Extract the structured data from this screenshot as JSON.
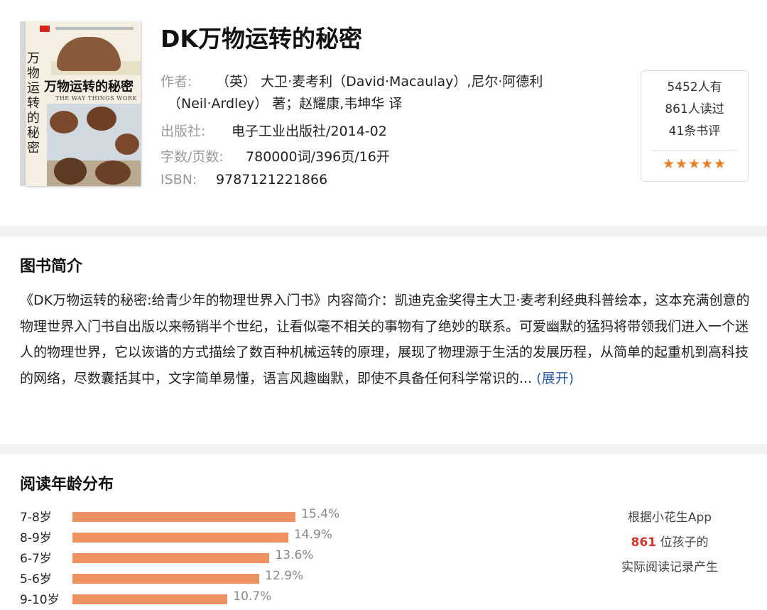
{
  "book": {
    "title": "DK万物运转的秘密",
    "author_label": "作者:",
    "author_line1": "（英） 大卫·麦考利（David·Macaulay）,尼尔·阿德利",
    "author_line2": "（Neil·Ardley） 著；赵耀康,韦坤华 译",
    "publisher_label": "出版社:",
    "publisher": "电子工业出版社/2014-02",
    "words_label": "字数/页数:",
    "words": "780000词/396页/16开",
    "isbn_label": "ISBN:",
    "isbn": "9787121221866"
  },
  "cover": {
    "vertical_title": "万物运转的秘密",
    "horizontal_title": "万物运转的秘密",
    "english_title": "THE WAY THINGS WORK"
  },
  "stats": {
    "owners": "5452人有",
    "readers": "861人读过",
    "reviews": "41条书评",
    "stars": "★★★★★",
    "star_color": "#ef7e23"
  },
  "intro": {
    "title": "图书简介",
    "text": "《DK万物运转的秘密:给青少年的物理世界入门书》内容简介：凯迪克金奖得主大卫·麦考利经典科普绘本，这本充满创意的物理世界入门书自出版以来畅销半个世纪，让看似毫不相关的事物有了绝妙的联系。可爱幽默的猛犸将带领我们进入一个迷人的物理世界，它以诙谐的方式描绘了数百种机械运转的原理，展现了物理源于生活的发展历程，从简单的起重机到高科技的网络，尽数囊括其中，文字简单易懂，语言风趣幽默，即使不具备任何科学常识的...",
    "more_label": "(展开)",
    "link_color": "#2e5fa8"
  },
  "age": {
    "title": "阅读年龄分布",
    "note_line1": "根据小花生App",
    "note_count": "861",
    "note_line2_rest": " 位孩子的",
    "note_line3": "实际阅读记录产生"
  },
  "chart_data": {
    "type": "bar",
    "orientation": "horizontal",
    "categories": [
      "7-8岁",
      "8-9岁",
      "6-7岁",
      "5-6岁",
      "9-10岁"
    ],
    "values": [
      15.4,
      14.9,
      13.6,
      12.9,
      10.7
    ],
    "value_labels": [
      "15.4%",
      "14.9%",
      "13.6%",
      "12.9%",
      "10.7%"
    ],
    "unit": "%",
    "bar_color": "#ee9262"
  }
}
